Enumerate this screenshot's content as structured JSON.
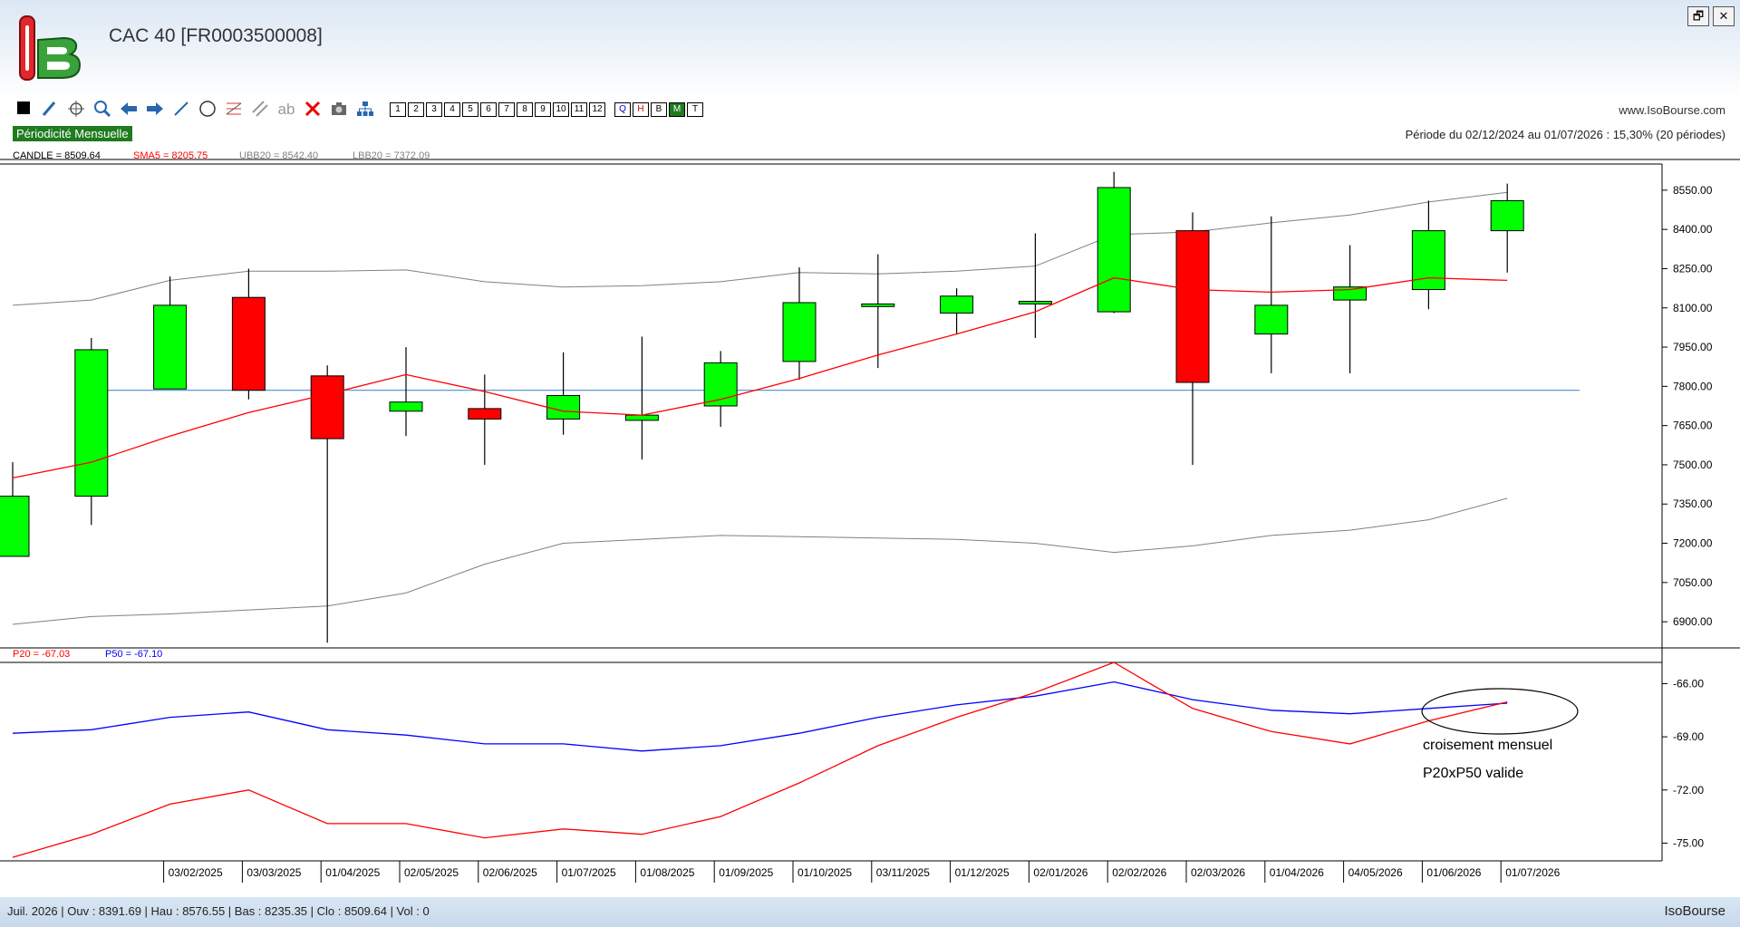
{
  "window": {
    "title": "CAC 40 [FR0003500008]",
    "restore_glyph": "🗗",
    "close_glyph": "✕"
  },
  "toolbar": {
    "icons": [
      "square-icon",
      "pencil-icon",
      "crosshair-icon",
      "zoom-icon",
      "arrow-left-icon",
      "arrow-right-icon",
      "line-icon",
      "circle-icon",
      "fibonacci-icon",
      "channel-icon",
      "text-icon",
      "delete-icon",
      "camera-icon",
      "hierarchy-icon"
    ],
    "numbers": [
      "1",
      "2",
      "3",
      "4",
      "5",
      "6",
      "7",
      "8",
      "9",
      "10",
      "11",
      "12"
    ],
    "periods": [
      "Q",
      "H",
      "B",
      "M",
      "T"
    ],
    "text_tool": "ab"
  },
  "header": {
    "site": "www.IsoBourse.com",
    "periodicity": "Périodicité Mensuelle",
    "period_text": "Période du 02/12/2024 au 01/07/2026 : 15,30% (20 périodes)"
  },
  "legend_main": {
    "candle": "CANDLE = 8509.64",
    "sma": "SMA5 = 8205.75",
    "ubb": "UBB20 = 8542.40",
    "lbb": "LBB20 = 7372.09"
  },
  "legend_sub": {
    "p20": "P20 = -67.03",
    "p50": "P50 = -67.10"
  },
  "annotation": {
    "line1": "croisement mensuel",
    "line2": "P20xP50 valide"
  },
  "status": {
    "left": "Juil. 2026 | Ouv : 8391.69 | Hau : 8576.55 | Bas : 8235.35 | Clo : 8509.64 | Vol : 0",
    "right": "IsoBourse"
  },
  "colors": {
    "up": "#00ff00",
    "down": "#ff0000",
    "sma": "#ff0000",
    "bollinger": "#808080",
    "p20": "#ff0000",
    "p50": "#0000ff",
    "hline": "#4a8fd0"
  },
  "chart_data": [
    {
      "type": "candlestick",
      "series_labels": [
        "CANDLE",
        "SMA5",
        "UBB20",
        "LBB20"
      ],
      "ylim": [
        6800,
        8650
      ],
      "y_ticks": [
        6900,
        7050,
        7200,
        7350,
        7500,
        7650,
        7800,
        7950,
        8100,
        8250,
        8400,
        8550
      ],
      "x_labels": [
        "03/02/2025",
        "03/03/2025",
        "01/04/2025",
        "02/05/2025",
        "02/06/2025",
        "01/07/2025",
        "01/08/2025",
        "01/09/2025",
        "01/10/2025",
        "03/11/2025",
        "01/12/2025",
        "02/01/2026",
        "02/02/2026",
        "02/03/2026",
        "01/04/2026",
        "04/05/2026",
        "01/06/2026",
        "01/07/2026"
      ],
      "candles": [
        {
          "o": 7150,
          "h": 7510,
          "l": 7150,
          "c": 7380
        },
        {
          "o": 7380,
          "h": 7985,
          "l": 7270,
          "c": 7940
        },
        {
          "o": 7790,
          "h": 8220,
          "l": 7790,
          "c": 8110
        },
        {
          "o": 8140,
          "h": 8250,
          "l": 7750,
          "c": 7785
        },
        {
          "o": 7840,
          "h": 7880,
          "l": 6820,
          "c": 7600
        },
        {
          "o": 7705,
          "h": 7950,
          "l": 7610,
          "c": 7740
        },
        {
          "o": 7715,
          "h": 7845,
          "l": 7500,
          "c": 7675
        },
        {
          "o": 7675,
          "h": 7930,
          "l": 7615,
          "c": 7765
        },
        {
          "o": 7670,
          "h": 7990,
          "l": 7520,
          "c": 7690
        },
        {
          "o": 7725,
          "h": 7935,
          "l": 7645,
          "c": 7890
        },
        {
          "o": 7895,
          "h": 8255,
          "l": 7825,
          "c": 8120
        },
        {
          "o": 8105,
          "h": 8305,
          "l": 7870,
          "c": 8115
        },
        {
          "o": 8080,
          "h": 8175,
          "l": 8000,
          "c": 8145
        },
        {
          "o": 8115,
          "h": 8385,
          "l": 7985,
          "c": 8125
        },
        {
          "o": 8085,
          "h": 8620,
          "l": 8080,
          "c": 8560
        },
        {
          "o": 8395,
          "h": 8465,
          "l": 7500,
          "c": 7815
        },
        {
          "o": 8000,
          "h": 8450,
          "l": 7850,
          "c": 8110
        },
        {
          "o": 8130,
          "h": 8340,
          "l": 7850,
          "c": 8180
        },
        {
          "o": 8170,
          "h": 8510,
          "l": 8095,
          "c": 8395
        },
        {
          "o": 8395,
          "h": 8575,
          "l": 8235,
          "c": 8510
        }
      ],
      "sma5": [
        7450,
        7510,
        7610,
        7700,
        7770,
        7845,
        7780,
        7705,
        7690,
        7750,
        7830,
        7920,
        8000,
        8085,
        8215,
        8170,
        8160,
        8170,
        8215,
        8205
      ],
      "ubb20": [
        8110,
        8130,
        8205,
        8240,
        8240,
        8245,
        8200,
        8180,
        8185,
        8200,
        8235,
        8230,
        8240,
        8260,
        8380,
        8390,
        8425,
        8455,
        8505,
        8542
      ],
      "lbb20": [
        6890,
        6920,
        6930,
        6945,
        6960,
        7010,
        7120,
        7200,
        7215,
        7230,
        7225,
        7220,
        7215,
        7200,
        7165,
        7190,
        7230,
        7250,
        7290,
        7372
      ],
      "hline": 7785
    },
    {
      "type": "line",
      "series_labels": [
        "P20",
        "P50"
      ],
      "ylim": [
        -76.0,
        -64.8
      ],
      "y_ticks": [
        -66.0,
        -69.0,
        -72.0,
        -75.0
      ],
      "p20": [
        -75.8,
        -74.5,
        -72.8,
        -72.0,
        -73.9,
        -73.9,
        -74.7,
        -74.2,
        -74.5,
        -73.5,
        -71.6,
        -69.5,
        -67.9,
        -66.5,
        -64.8,
        -67.4,
        -68.7,
        -69.4,
        -68.1,
        -67.03
      ],
      "p50": [
        -68.8,
        -68.6,
        -67.9,
        -67.6,
        -68.6,
        -68.9,
        -69.4,
        -69.4,
        -69.8,
        -69.5,
        -68.8,
        -67.9,
        -67.2,
        -66.7,
        -65.9,
        -66.9,
        -67.5,
        -67.7,
        -67.4,
        -67.1
      ]
    }
  ]
}
